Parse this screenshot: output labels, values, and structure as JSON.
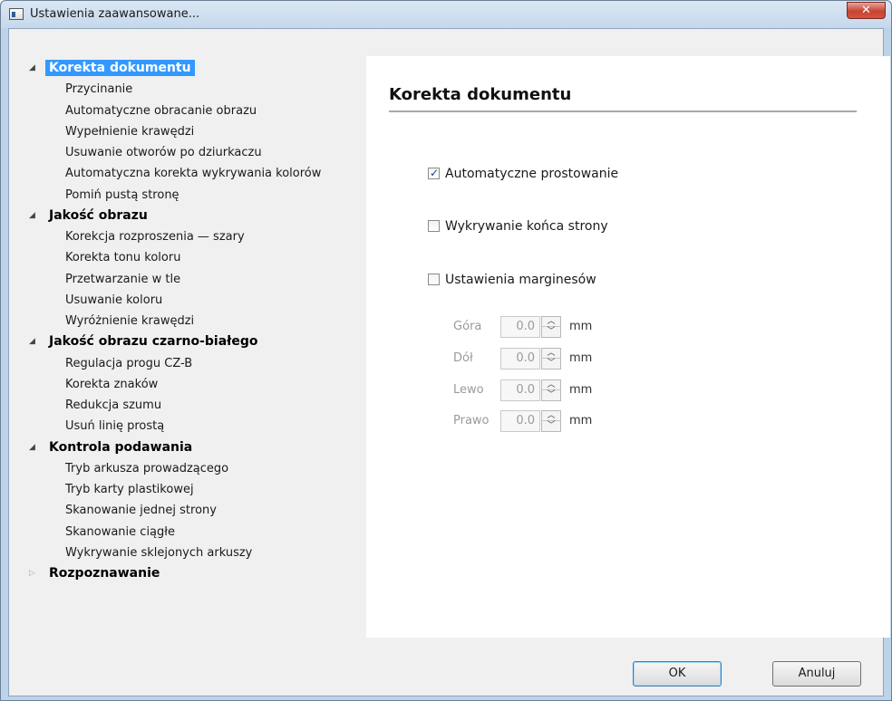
{
  "window": {
    "title": "Ustawienia zaawansowane...",
    "close_label": "✕"
  },
  "tree": [
    {
      "label": "Korekta dokumentu",
      "expanded": true,
      "selected": true,
      "items": [
        "Przycinanie",
        "Automatyczne obracanie obrazu",
        "Wypełnienie krawędzi",
        "Usuwanie otworów po dziurkaczu",
        "Automatyczna korekta wykrywania kolorów",
        "Pomiń pustą stronę"
      ]
    },
    {
      "label": "Jakość obrazu",
      "expanded": true,
      "selected": false,
      "items": [
        "Korekcja rozproszenia — szary",
        "Korekta tonu koloru",
        "Przetwarzanie w tle",
        "Usuwanie koloru",
        "Wyróżnienie krawędzi"
      ]
    },
    {
      "label": "Jakość obrazu czarno-białego",
      "expanded": true,
      "selected": false,
      "items": [
        "Regulacja progu CZ-B",
        "Korekta znaków",
        "Redukcja szumu",
        "Usuń linię prostą"
      ]
    },
    {
      "label": "Kontrola podawania",
      "expanded": true,
      "selected": false,
      "items": [
        "Tryb arkusza prowadzącego",
        "Tryb karty plastikowej",
        "Skanowanie jednej strony",
        "Skanowanie ciągłe",
        "Wykrywanie sklejonych arkuszy"
      ]
    },
    {
      "label": "Rozpoznawanie",
      "expanded": false,
      "selected": false,
      "items": []
    }
  ],
  "panel": {
    "title": "Korekta dokumentu",
    "checkboxes": [
      {
        "label": "Automatyczne prostowanie",
        "checked": true
      },
      {
        "label": "Wykrywanie końca strony",
        "checked": false
      },
      {
        "label": "Ustawienia marginesów",
        "checked": false
      }
    ],
    "margins": [
      {
        "label": "Góra",
        "value": "0.0",
        "unit": "mm"
      },
      {
        "label": "Dół",
        "value": "0.0",
        "unit": "mm"
      },
      {
        "label": "Lewo",
        "value": "0.0",
        "unit": "mm"
      },
      {
        "label": "Prawo",
        "value": "0.0",
        "unit": "mm"
      }
    ]
  },
  "buttons": {
    "ok": "OK",
    "cancel": "Anuluj"
  },
  "colors": {
    "selection": "#3399ff",
    "close": "#c64433"
  }
}
